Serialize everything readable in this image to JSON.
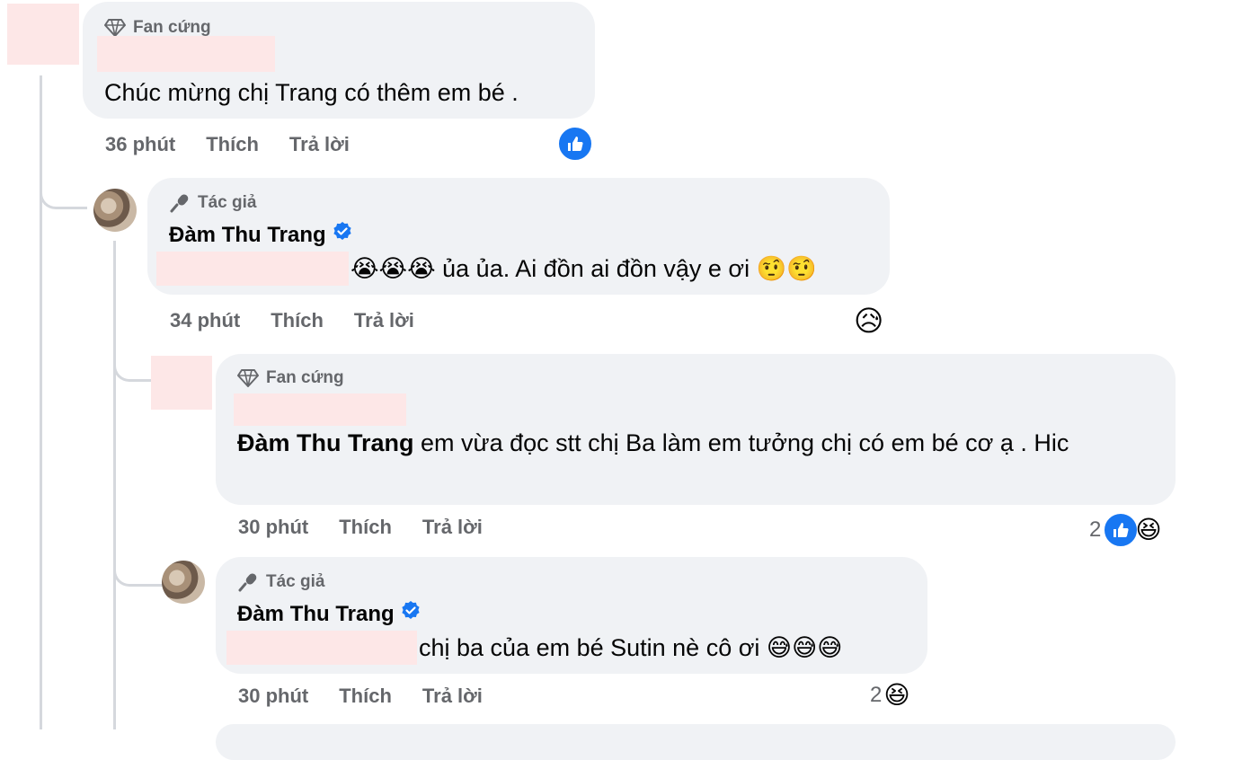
{
  "comments": [
    {
      "badge": "Fan cứng",
      "author": "",
      "text": "Chúc mừng chị Trang có thêm em bé .",
      "time": "36 phút",
      "like_label": "Thích",
      "reply_label": "Trả lời",
      "reactions": {
        "count": "",
        "types": [
          "like"
        ]
      }
    },
    {
      "badge": "Tác giả",
      "author": "Đàm Thu Trang",
      "verified": true,
      "text": "😭😭😭 ủa ủa. Ai đồn ai đồn vậy e ơi 🤨🤨",
      "time": "34 phút",
      "like_label": "Thích",
      "reply_label": "Trả lời",
      "reactions": {
        "count": "",
        "types": [
          "sad"
        ]
      }
    },
    {
      "badge": "Fan cứng",
      "author": "",
      "mention": "Đàm Thu Trang",
      "text": " em vừa đọc stt chị Ba làm em tưởng chị có em bé cơ ạ . Hic",
      "time": "30 phút",
      "like_label": "Thích",
      "reply_label": "Trả lời",
      "reactions": {
        "count": "2",
        "types": [
          "like",
          "haha"
        ]
      }
    },
    {
      "badge": "Tác giả",
      "author": "Đàm Thu Trang",
      "verified": true,
      "text": "chị ba của em bé Sutin nè cô ơi 😅😅😅",
      "time": "30 phút",
      "like_label": "Thích",
      "reply_label": "Trả lời",
      "reactions": {
        "count": "2",
        "types": [
          "haha"
        ]
      }
    }
  ],
  "colors": {
    "bubble": "#f0f2f5",
    "meta_text": "#65676b",
    "like_blue": "#1877f2",
    "verified_blue": "#1877f2"
  },
  "emoji": {
    "sad": "😥",
    "haha": "😆"
  }
}
